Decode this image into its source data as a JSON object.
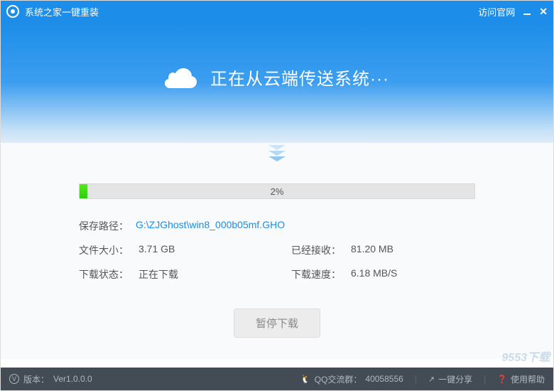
{
  "titlebar": {
    "title": "系统之家一键重装",
    "official_link": "访问官网"
  },
  "hero": {
    "title": "正在从云端传送系统···"
  },
  "progress": {
    "percent": "2%",
    "fill_width": "2%"
  },
  "info": {
    "save_path_label": "保存路径：",
    "save_path_value": "G:\\ZJGhost\\win8_000b05mf.GHO",
    "file_size_label": "文件大小：",
    "file_size_value": "3.71 GB",
    "received_label": "已经接收：",
    "received_value": "81.20 MB",
    "status_label": "下载状态：",
    "status_value": "正在下载",
    "speed_label": "下载速度：",
    "speed_value": "6.18 MB/S"
  },
  "buttons": {
    "pause_label": "暂停下载"
  },
  "footer": {
    "version_label": "版本：",
    "version_value": "Ver1.0.0.0",
    "qq_label": "QQ交流群：",
    "qq_value": "40058556",
    "share_label": "一键分享",
    "help_label": "使用帮助"
  },
  "watermark": "9553下载"
}
